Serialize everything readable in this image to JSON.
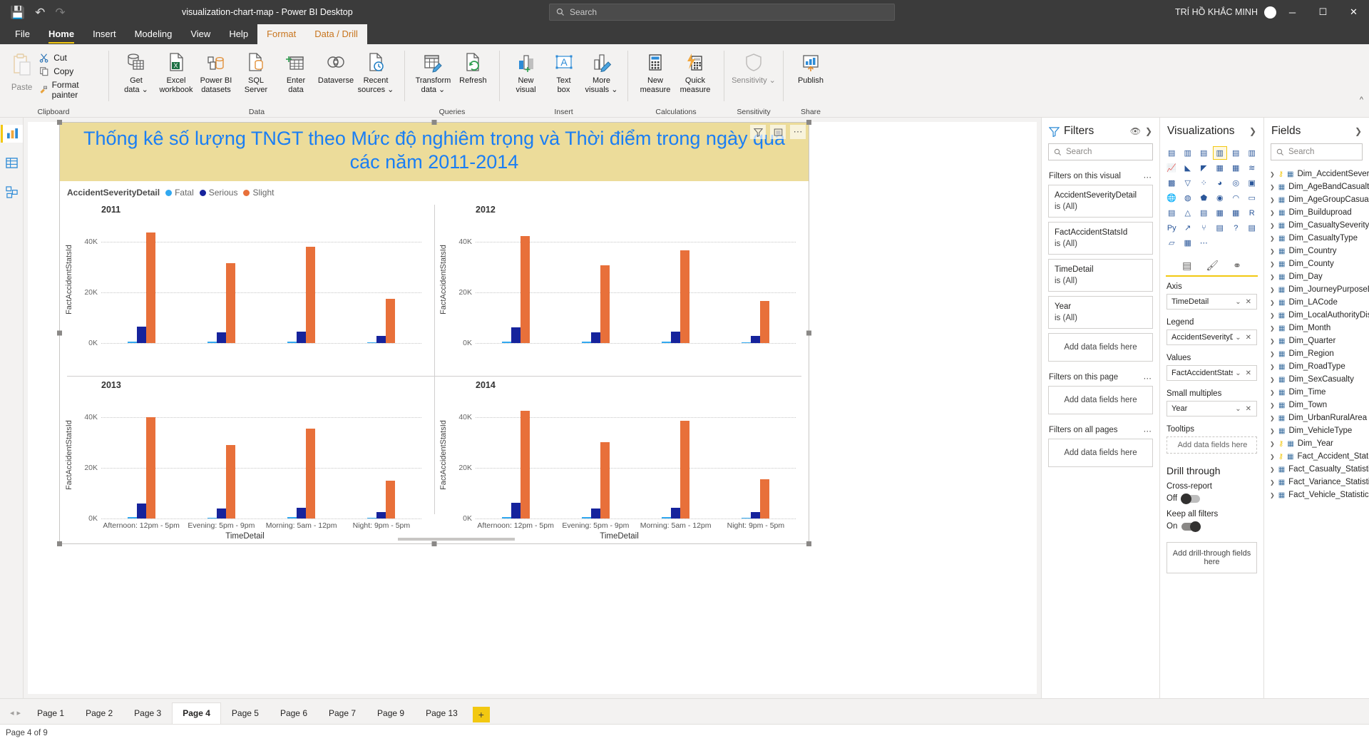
{
  "titlebar": {
    "document_title": "visualization-chart-map - Power BI Desktop",
    "save_icon": "save-icon",
    "undo_icon": "undo-icon",
    "redo_icon": "redo-icon",
    "search_placeholder": "Search",
    "user_name": "TRÍ HỒ KHẮC MINH",
    "minimize": "─",
    "maximize": "☐",
    "close": "✕"
  },
  "menu": {
    "tabs": [
      {
        "label": "File",
        "state": "normal"
      },
      {
        "label": "Home",
        "state": "active"
      },
      {
        "label": "Insert",
        "state": "normal"
      },
      {
        "label": "Modeling",
        "state": "normal"
      },
      {
        "label": "View",
        "state": "normal"
      },
      {
        "label": "Help",
        "state": "normal"
      },
      {
        "label": "Format",
        "state": "context"
      },
      {
        "label": "Data / Drill",
        "state": "context"
      }
    ]
  },
  "ribbon": {
    "groups": [
      {
        "name": "Clipboard",
        "paste": "Paste",
        "small": [
          {
            "label": "Cut",
            "icon": "scissors-icon"
          },
          {
            "label": "Copy",
            "icon": "copy-icon"
          },
          {
            "label": "Format painter",
            "icon": "paintbrush-icon"
          }
        ]
      },
      {
        "name": "Data",
        "buttons": [
          {
            "label": "Get\ndata ⌄",
            "icon": "get-data-icon"
          },
          {
            "label": "Excel\nworkbook",
            "icon": "excel-icon"
          },
          {
            "label": "Power BI\ndatasets",
            "icon": "powerbi-datasets-icon"
          },
          {
            "label": "SQL\nServer",
            "icon": "sql-server-icon"
          },
          {
            "label": "Enter\ndata",
            "icon": "enter-data-icon"
          },
          {
            "label": "Dataverse",
            "icon": "dataverse-icon"
          },
          {
            "label": "Recent\nsources ⌄",
            "icon": "recent-sources-icon"
          }
        ]
      },
      {
        "name": "Queries",
        "buttons": [
          {
            "label": "Transform\ndata ⌄",
            "icon": "transform-data-icon"
          },
          {
            "label": "Refresh",
            "icon": "refresh-icon"
          }
        ]
      },
      {
        "name": "Insert",
        "buttons": [
          {
            "label": "New\nvisual",
            "icon": "new-visual-icon"
          },
          {
            "label": "Text\nbox",
            "icon": "text-box-icon"
          },
          {
            "label": "More\nvisuals ⌄",
            "icon": "more-visuals-icon"
          }
        ]
      },
      {
        "name": "Calculations",
        "buttons": [
          {
            "label": "New\nmeasure",
            "icon": "new-measure-icon"
          },
          {
            "label": "Quick\nmeasure",
            "icon": "quick-measure-icon"
          }
        ]
      },
      {
        "name": "Sensitivity",
        "buttons": [
          {
            "label": "Sensitivity ⌄",
            "icon": "sensitivity-icon"
          }
        ]
      },
      {
        "name": "Share",
        "buttons": [
          {
            "label": "Publish",
            "icon": "publish-icon"
          }
        ]
      }
    ]
  },
  "leftrail": {
    "items": [
      {
        "icon": "report-view-icon",
        "name": "report-view",
        "active": true
      },
      {
        "icon": "data-view-icon",
        "name": "data-view",
        "active": false
      },
      {
        "icon": "model-view-icon",
        "name": "model-view",
        "active": false
      }
    ]
  },
  "visual": {
    "title": "Thống kê số lượng TNGT theo Mức độ nghiêm trọng và Thời điểm trong ngày qua các năm 2011-2014",
    "title_color": "#1a7ef4",
    "title_background": "#ecdc9a",
    "toolbar": [
      {
        "icon": "filter-icon",
        "name": "visual-filter-icon"
      },
      {
        "icon": "focus-mode-icon",
        "name": "visual-focus-icon"
      },
      {
        "icon": "more-options-icon",
        "name": "visual-more-icon"
      }
    ]
  },
  "chart_data": {
    "type": "bar",
    "title": "Thống kê số lượng TNGT theo Mức độ nghiêm trọng và Thời điểm trong ngày qua các năm 2011-2014",
    "legend_title": "AccidentSeverityDetail",
    "legend_position": "top-left",
    "xlabel": "TimeDetail",
    "ylabel": "FactAccidentStatsId",
    "ylim": [
      0,
      50000
    ],
    "yticks": [
      "0K",
      "20K",
      "40K"
    ],
    "ytick_values": [
      0,
      20000,
      40000
    ],
    "grid": true,
    "small_multiples_field": "Year",
    "categories": [
      "Afternoon: 12pm - 5pm",
      "Evening: 5pm - 9pm",
      "Morning: 5am - 12pm",
      "Night: 9pm - 5pm"
    ],
    "legend": [
      {
        "name": "Fatal",
        "color": "#31a8f0"
      },
      {
        "name": "Serious",
        "color": "#16239c"
      },
      {
        "name": "Slight",
        "color": "#e8703a"
      }
    ],
    "panels": [
      {
        "title": "2011",
        "series": [
          {
            "name": "Fatal",
            "color": "#31a8f0",
            "values": [
              600,
              450,
              500,
              400
            ]
          },
          {
            "name": "Serious",
            "color": "#16239c",
            "values": [
              6400,
              4200,
              4600,
              2800
            ]
          },
          {
            "name": "Slight",
            "color": "#e8703a",
            "values": [
              43500,
              31500,
              38000,
              17500
            ]
          }
        ]
      },
      {
        "title": "2012",
        "series": [
          {
            "name": "Fatal",
            "color": "#31a8f0",
            "values": [
              600,
              450,
              500,
              400
            ]
          },
          {
            "name": "Serious",
            "color": "#16239c",
            "values": [
              6200,
              4100,
              4400,
              2700
            ]
          },
          {
            "name": "Slight",
            "color": "#e8703a",
            "values": [
              42000,
              30500,
              36500,
              16500
            ]
          }
        ]
      },
      {
        "title": "2013",
        "series": [
          {
            "name": "Fatal",
            "color": "#31a8f0",
            "values": [
              550,
              420,
              480,
              380
            ]
          },
          {
            "name": "Serious",
            "color": "#16239c",
            "values": [
              5900,
              3900,
              4200,
              2500
            ]
          },
          {
            "name": "Slight",
            "color": "#e8703a",
            "values": [
              40000,
              29000,
              35500,
              15000
            ]
          }
        ]
      },
      {
        "title": "2014",
        "series": [
          {
            "name": "Fatal",
            "color": "#31a8f0",
            "values": [
              560,
              430,
              490,
              390
            ]
          },
          {
            "name": "Serious",
            "color": "#16239c",
            "values": [
              6100,
              4000,
              4300,
              2600
            ]
          },
          {
            "name": "Slight",
            "color": "#e8703a",
            "values": [
              42500,
              30000,
              38500,
              15500
            ]
          }
        ]
      }
    ]
  },
  "filters": {
    "pane_title": "Filters",
    "search_placeholder": "Search",
    "sections": [
      {
        "label": "Filters on this visual",
        "cards": [
          {
            "field": "AccidentSeverityDetail",
            "state": "is (All)"
          },
          {
            "field": "FactAccidentStatsId",
            "state": "is (All)"
          },
          {
            "field": "TimeDetail",
            "state": "is (All)"
          },
          {
            "field": "Year",
            "state": "is (All)"
          }
        ],
        "dropzone": "Add data fields here"
      },
      {
        "label": "Filters on this page",
        "cards": [],
        "dropzone": "Add data fields here"
      },
      {
        "label": "Filters on all pages",
        "cards": [],
        "dropzone": "Add data fields here"
      }
    ],
    "hide_icon": "eye-icon",
    "expand_icon": "chevron-right-icon"
  },
  "visualizations": {
    "pane_title": "Visualizations",
    "expand_icon": "chevron-right-icon",
    "gallery_rows": [
      [
        "stacked-bar-chart",
        "stacked-column-chart",
        "clustered-bar-chart",
        "clustered-column-chart",
        "100-stacked-bar-chart",
        "100-stacked-column-chart"
      ],
      [
        "line-chart",
        "area-chart",
        "stacked-area-chart",
        "line-stacked-column-chart",
        "line-clustered-column-chart",
        "ribbon-chart"
      ],
      [
        "waterfall-chart",
        "funnel-chart",
        "scatter-chart",
        "pie-chart",
        "donut-chart",
        "treemap"
      ],
      [
        "map",
        "filled-map",
        "shape-map",
        "azure-map",
        "gauge",
        "card"
      ],
      [
        "multi-row-card",
        "kpi",
        "slicer",
        "table",
        "matrix",
        "r-script-visual"
      ],
      [
        "python-visual",
        "key-influencers",
        "decomposition-tree",
        "smart-narrative",
        "q-and-a",
        "paginated-report"
      ],
      [
        "power-apps",
        "get-more-visuals",
        "more-options"
      ]
    ],
    "selected_visual": "clustered-column-chart",
    "tabs": [
      {
        "icon": "fields-tab-icon",
        "name": "fields-tab",
        "active": true
      },
      {
        "icon": "format-tab-icon",
        "name": "format-tab",
        "active": false
      },
      {
        "icon": "analytics-tab-icon",
        "name": "analytics-tab",
        "active": false
      }
    ],
    "wells": [
      {
        "label": "Axis",
        "value": "TimeDetail",
        "filled": true
      },
      {
        "label": "Legend",
        "value": "AccidentSeverityDetail",
        "filled": true
      },
      {
        "label": "Values",
        "value": "FactAccidentStatsId",
        "filled": true
      },
      {
        "label": "Small multiples",
        "value": "Year",
        "filled": true
      },
      {
        "label": "Tooltips",
        "value": "Add data fields here",
        "filled": false
      }
    ],
    "drill_through": {
      "heading": "Drill through",
      "cross_report_label": "Cross-report",
      "cross_report_state": "Off",
      "keep_all_filters_label": "Keep all filters",
      "keep_all_filters_state": "On",
      "dropzone": "Add drill-through fields here"
    }
  },
  "fields": {
    "pane_title": "Fields",
    "expand_icon": "chevron-right-icon",
    "search_placeholder": "Search",
    "items": [
      {
        "label": "Dim_AccidentSeverity",
        "icon": "table-key-icon"
      },
      {
        "label": "Dim_AgeBandCasualty",
        "icon": "table-icon"
      },
      {
        "label": "Dim_AgeGroupCasualty",
        "icon": "table-icon"
      },
      {
        "label": "Dim_Builduproad",
        "icon": "table-icon"
      },
      {
        "label": "Dim_CasualtySeverity",
        "icon": "table-icon"
      },
      {
        "label": "Dim_CasualtyType",
        "icon": "table-icon"
      },
      {
        "label": "Dim_Country",
        "icon": "table-icon"
      },
      {
        "label": "Dim_County",
        "icon": "table-icon"
      },
      {
        "label": "Dim_Day",
        "icon": "table-icon"
      },
      {
        "label": "Dim_JourneyPurposeDr...",
        "icon": "table-icon"
      },
      {
        "label": "Dim_LACode",
        "icon": "table-icon"
      },
      {
        "label": "Dim_LocalAuthorityDist...",
        "icon": "table-icon"
      },
      {
        "label": "Dim_Month",
        "icon": "table-icon"
      },
      {
        "label": "Dim_Quarter",
        "icon": "table-icon"
      },
      {
        "label": "Dim_Region",
        "icon": "table-icon"
      },
      {
        "label": "Dim_RoadType",
        "icon": "table-icon"
      },
      {
        "label": "Dim_SexCasualty",
        "icon": "table-icon"
      },
      {
        "label": "Dim_Time",
        "icon": "table-icon"
      },
      {
        "label": "Dim_Town",
        "icon": "table-icon"
      },
      {
        "label": "Dim_UrbanRuralArea",
        "icon": "table-icon"
      },
      {
        "label": "Dim_VehicleType",
        "icon": "table-icon"
      },
      {
        "label": "Dim_Year",
        "icon": "table-key-icon"
      },
      {
        "label": "Fact_Accident_Statistic",
        "icon": "table-key-icon"
      },
      {
        "label": "Fact_Casualty_Statistic",
        "icon": "table-icon"
      },
      {
        "label": "Fact_Variance_Statistic",
        "icon": "table-icon"
      },
      {
        "label": "Fact_Vehicle_Statistic",
        "icon": "table-icon"
      }
    ]
  },
  "pagebar": {
    "prev_icon": "◂",
    "next_icon": "▸",
    "tabs": [
      {
        "label": "Page 1",
        "active": false
      },
      {
        "label": "Page 2",
        "active": false
      },
      {
        "label": "Page 3",
        "active": false
      },
      {
        "label": "Page 4",
        "active": true
      },
      {
        "label": "Page 5",
        "active": false
      },
      {
        "label": "Page 6",
        "active": false
      },
      {
        "label": "Page 7",
        "active": false
      },
      {
        "label": "Page 9",
        "active": false
      },
      {
        "label": "Page 13",
        "active": false
      }
    ],
    "add_label": "+"
  },
  "statusbar": {
    "text": "Page 4 of 9"
  }
}
